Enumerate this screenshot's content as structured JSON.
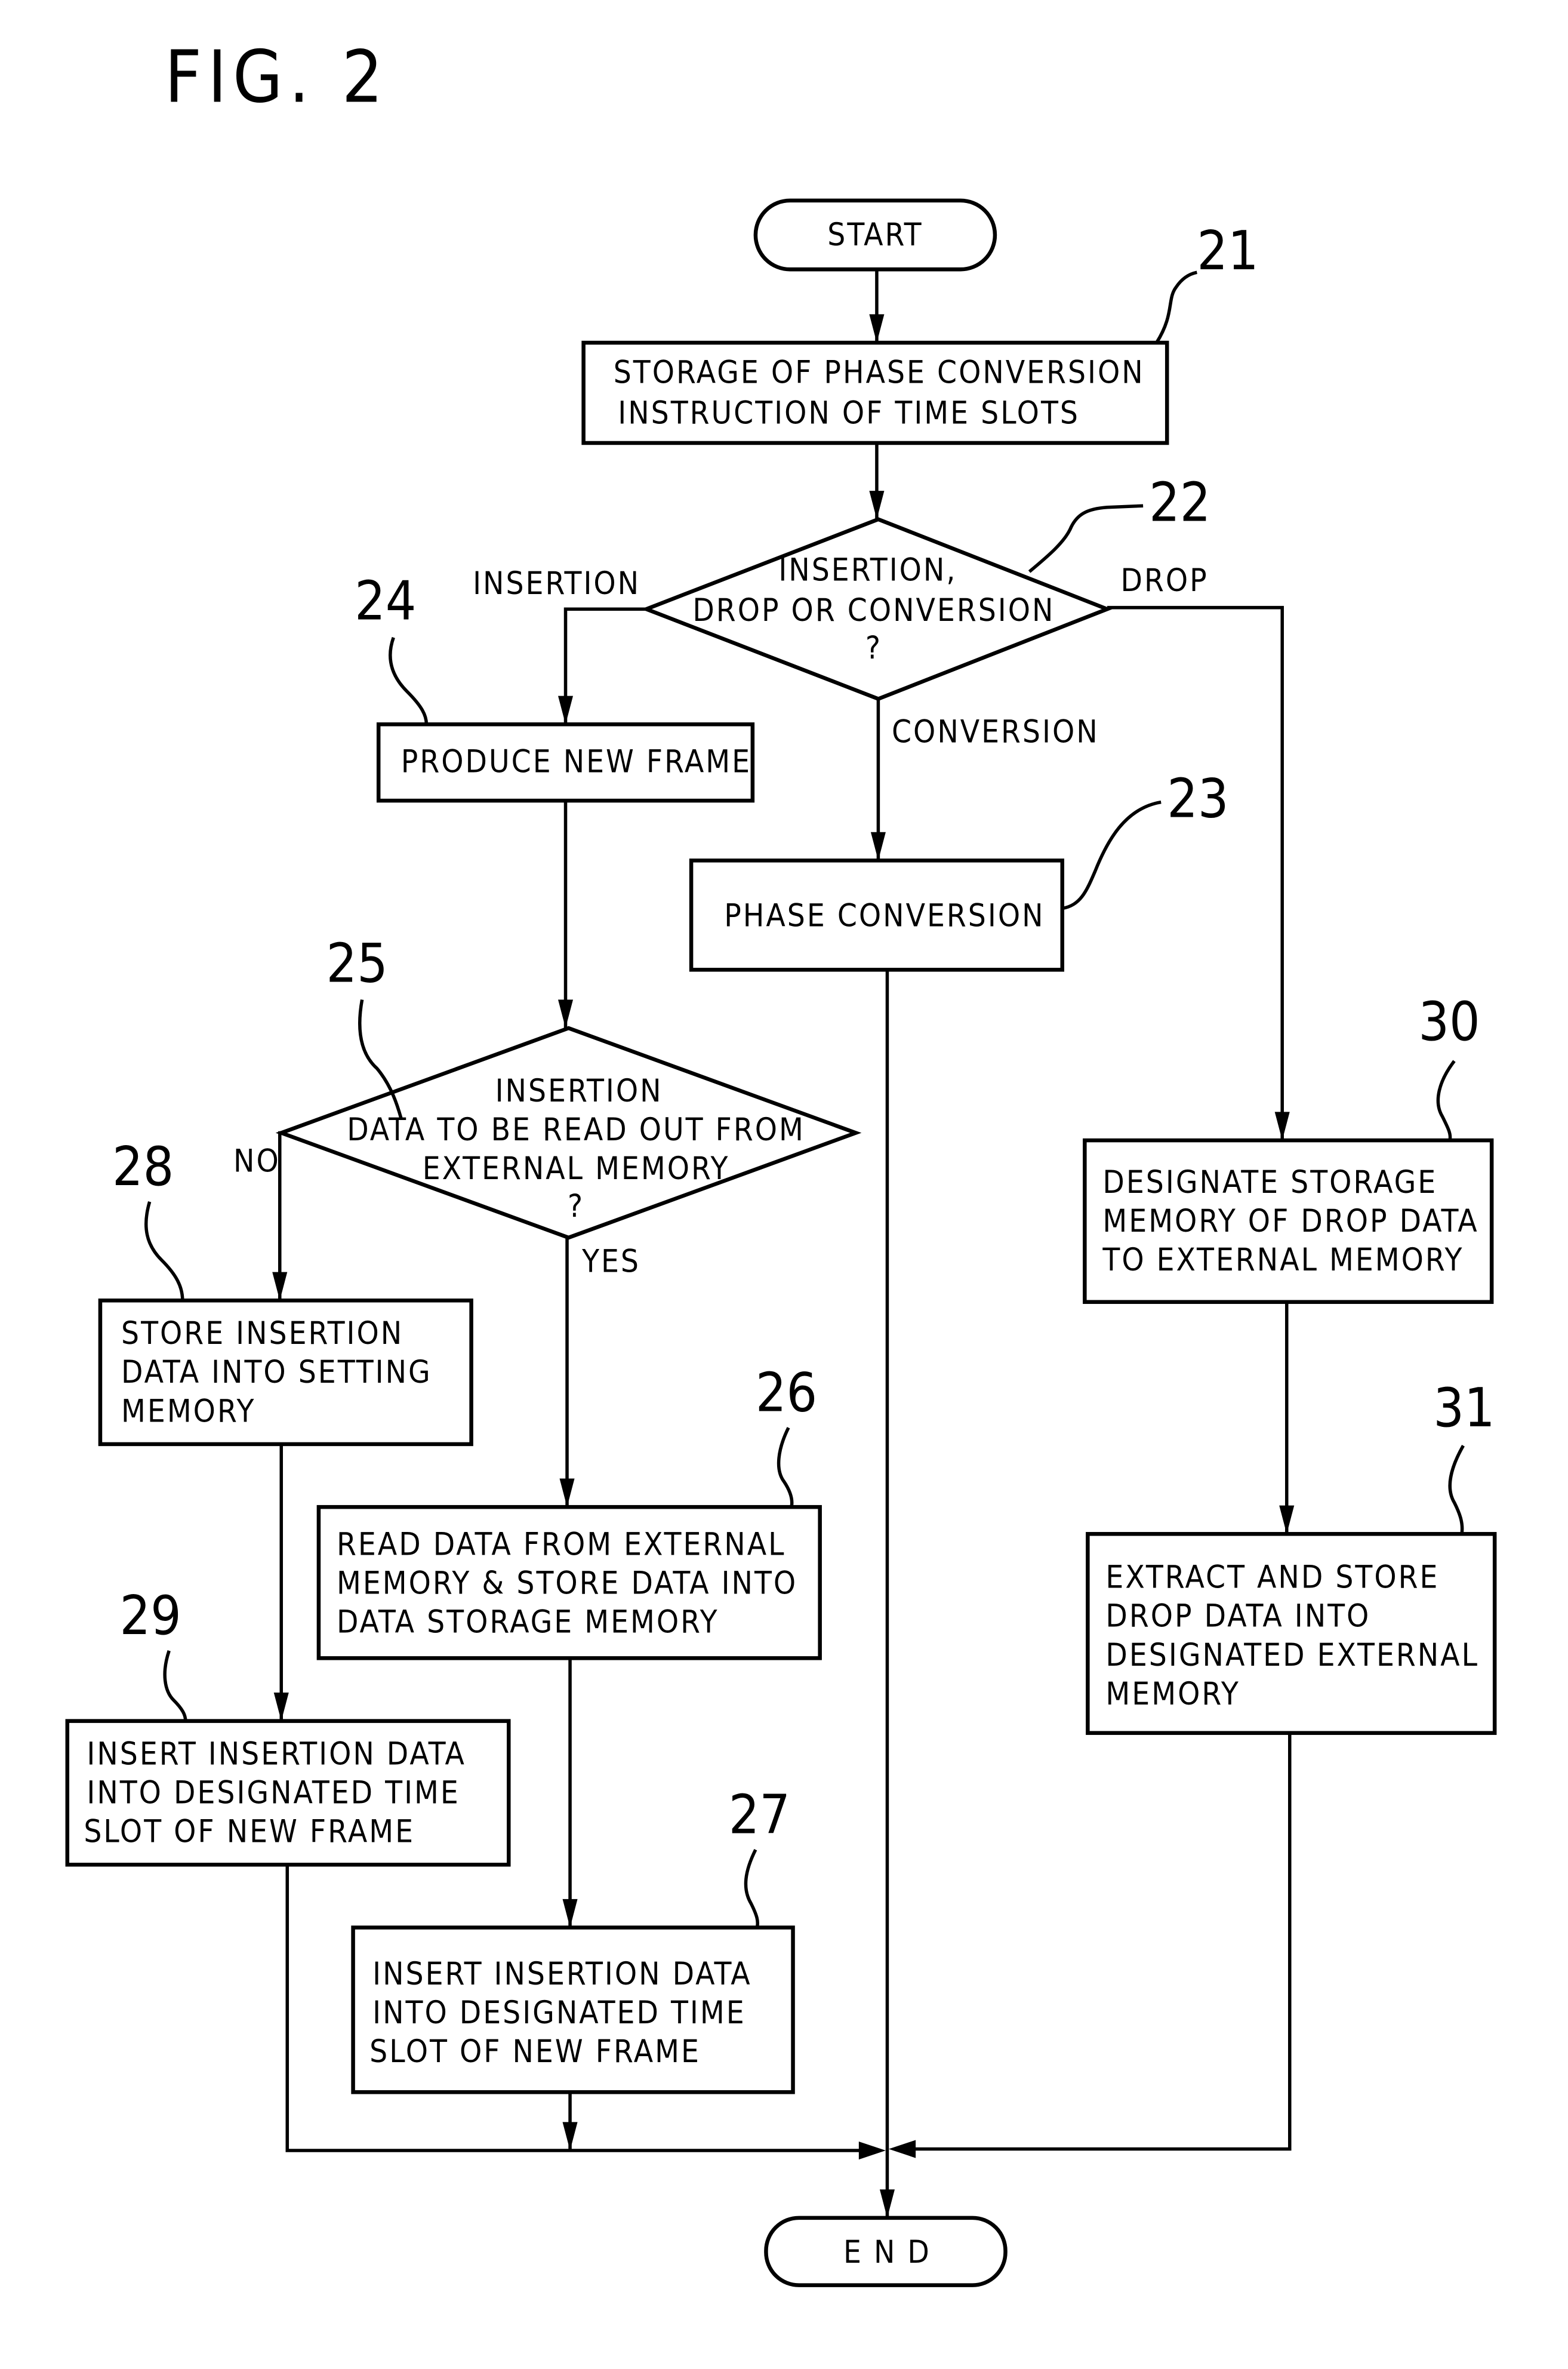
{
  "figure": {
    "title": "FIG. 2",
    "type": "flowchart",
    "ink_color": "#000000",
    "background_color": "#ffffff"
  },
  "terminals": {
    "start": "START",
    "end": "E N D"
  },
  "steps": {
    "s21": {
      "ref": "21",
      "lines": [
        "STORAGE OF PHASE CONVERSION",
        "INSTRUCTION OF TIME SLOTS"
      ]
    },
    "s22": {
      "ref": "22",
      "lines": [
        "INSERTION,",
        "DROP OR CONVERSION",
        "?"
      ]
    },
    "s23": {
      "ref": "23",
      "lines": [
        "PHASE CONVERSION"
      ]
    },
    "s24": {
      "ref": "24",
      "lines": [
        "PRODUCE NEW FRAME"
      ]
    },
    "s25": {
      "ref": "25",
      "lines": [
        "INSERTION",
        "DATA TO BE READ OUT FROM",
        "EXTERNAL MEMORY",
        "?"
      ]
    },
    "s26": {
      "ref": "26",
      "lines": [
        "READ DATA FROM EXTERNAL",
        "MEMORY & STORE DATA INTO",
        "DATA STORAGE MEMORY"
      ]
    },
    "s27": {
      "ref": "27",
      "lines": [
        "INSERT INSERTION DATA",
        "INTO DESIGNATED TIME",
        "SLOT OF NEW FRAME"
      ]
    },
    "s28": {
      "ref": "28",
      "lines": [
        "STORE INSERTION",
        "DATA INTO SETTING",
        "MEMORY"
      ]
    },
    "s29": {
      "ref": "29",
      "lines": [
        "INSERT INSERTION DATA",
        "INTO DESIGNATED TIME",
        "SLOT OF NEW FRAME"
      ]
    },
    "s30": {
      "ref": "30",
      "lines": [
        "DESIGNATE STORAGE",
        "MEMORY OF DROP DATA",
        "TO EXTERNAL MEMORY"
      ]
    },
    "s31": {
      "ref": "31",
      "lines": [
        "EXTRACT AND STORE",
        "DROP DATA INTO",
        "DESIGNATED EXTERNAL",
        "MEMORY"
      ]
    }
  },
  "branches": {
    "insertion": "INSERTION",
    "drop": "DROP",
    "conversion": "CONVERSION",
    "no": "NO",
    "yes": "YES"
  },
  "edges": [
    {
      "from": "start",
      "to": "s21"
    },
    {
      "from": "s21",
      "to": "s22"
    },
    {
      "from": "s22",
      "to": "s24",
      "label": "INSERTION"
    },
    {
      "from": "s22",
      "to": "s23",
      "label": "CONVERSION"
    },
    {
      "from": "s22",
      "to": "s30",
      "label": "DROP"
    },
    {
      "from": "s24",
      "to": "s25"
    },
    {
      "from": "s25",
      "to": "s28",
      "label": "NO"
    },
    {
      "from": "s25",
      "to": "s26",
      "label": "YES"
    },
    {
      "from": "s28",
      "to": "s29"
    },
    {
      "from": "s26",
      "to": "s27"
    },
    {
      "from": "s30",
      "to": "s31"
    },
    {
      "from": "s29",
      "to": "end"
    },
    {
      "from": "s27",
      "to": "end"
    },
    {
      "from": "s23",
      "to": "end"
    },
    {
      "from": "s31",
      "to": "end"
    }
  ]
}
